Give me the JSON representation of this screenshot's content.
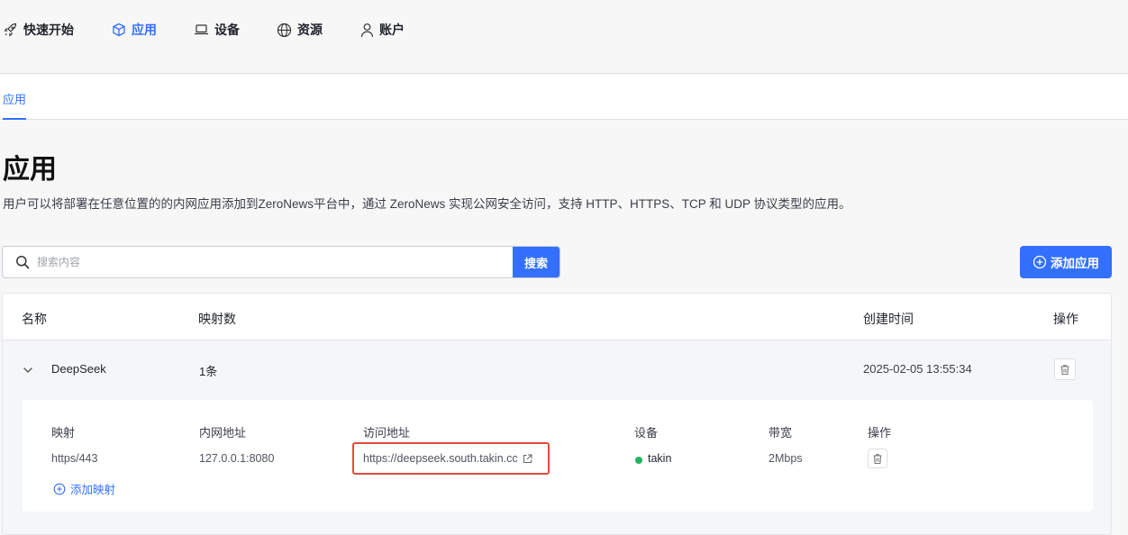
{
  "nav": {
    "items": [
      {
        "label": "快速开始",
        "icon": "rocket-icon"
      },
      {
        "label": "应用",
        "icon": "cube-icon",
        "active": true
      },
      {
        "label": "设备",
        "icon": "laptop-icon"
      },
      {
        "label": "资源",
        "icon": "globe-icon"
      },
      {
        "label": "账户",
        "icon": "user-icon"
      }
    ]
  },
  "subnav": {
    "tab": "应用"
  },
  "page": {
    "title": "应用",
    "description": "用户可以将部署在任意位置的的内网应用添加到ZeroNews平台中，通过 ZeroNews 实现公网安全访问，支持 HTTP、HTTPS、TCP 和 UDP 协议类型的应用。"
  },
  "search": {
    "placeholder": "搜索内容",
    "value": "",
    "button": "搜索"
  },
  "add_app_label": "添加应用",
  "table": {
    "headers": {
      "name": "名称",
      "mappings": "映射数",
      "created": "创建时间",
      "actions": "操作"
    },
    "rows": [
      {
        "name": "DeepSeek",
        "mapping_count": "1条",
        "created_at": "2025-02-05 13:55:34",
        "expanded": true,
        "detail": {
          "headers": {
            "mapping": "映射",
            "intranet": "内网地址",
            "access": "访问地址",
            "device": "设备",
            "bandwidth": "带宽",
            "actions": "操作"
          },
          "mappings": [
            {
              "mapping": "https/443",
              "intranet": "127.0.0.1:8080",
              "access": "https://deepseek.south.takin.cc",
              "device": "takin",
              "device_status_color": "#22b35e",
              "bandwidth": "2Mbps"
            }
          ],
          "add_mapping_label": "添加映射"
        }
      }
    ]
  },
  "colors": {
    "accent": "#3370ff",
    "highlight": "#e04b3d",
    "online": "#22b35e"
  }
}
